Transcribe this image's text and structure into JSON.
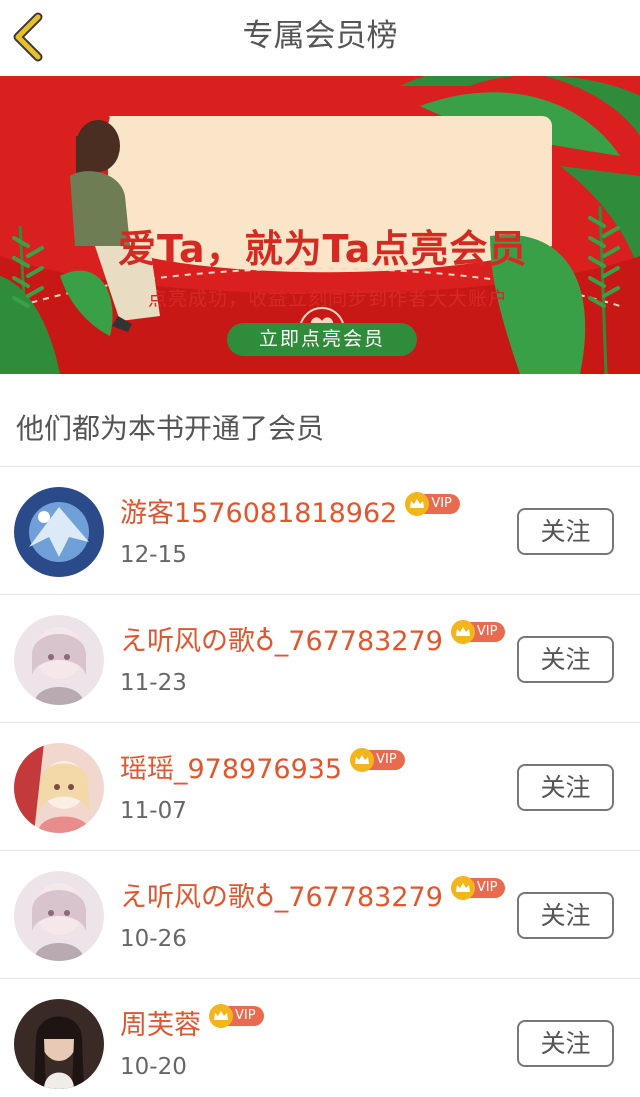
{
  "header": {
    "title": "专属会员榜"
  },
  "banner": {
    "headline": "爱Ta，就为Ta点亮会员",
    "subtitle": "点亮成功，收益立刻同步到作者大大账户",
    "cta_label": "立即点亮会员"
  },
  "section_title": "他们都为本书开通了会员",
  "vip_badge_label": "VIP",
  "follow_label": "关注",
  "members": [
    {
      "name": "游客1576081818962",
      "date": "12-15"
    },
    {
      "name": "え听风の歌♁_767783279",
      "date": "11-23"
    },
    {
      "name": "瑶瑶_978976935",
      "date": "11-07"
    },
    {
      "name": "え听风の歌♁_767783279",
      "date": "10-26"
    },
    {
      "name": "周芙蓉",
      "date": "10-20"
    }
  ],
  "colors": {
    "accent_name": "#e0572f",
    "banner_red": "#d9201f",
    "cta_green": "#2f8c3a",
    "vip_gold": "#f3b51c",
    "back_arrow": "#e8c02c"
  }
}
